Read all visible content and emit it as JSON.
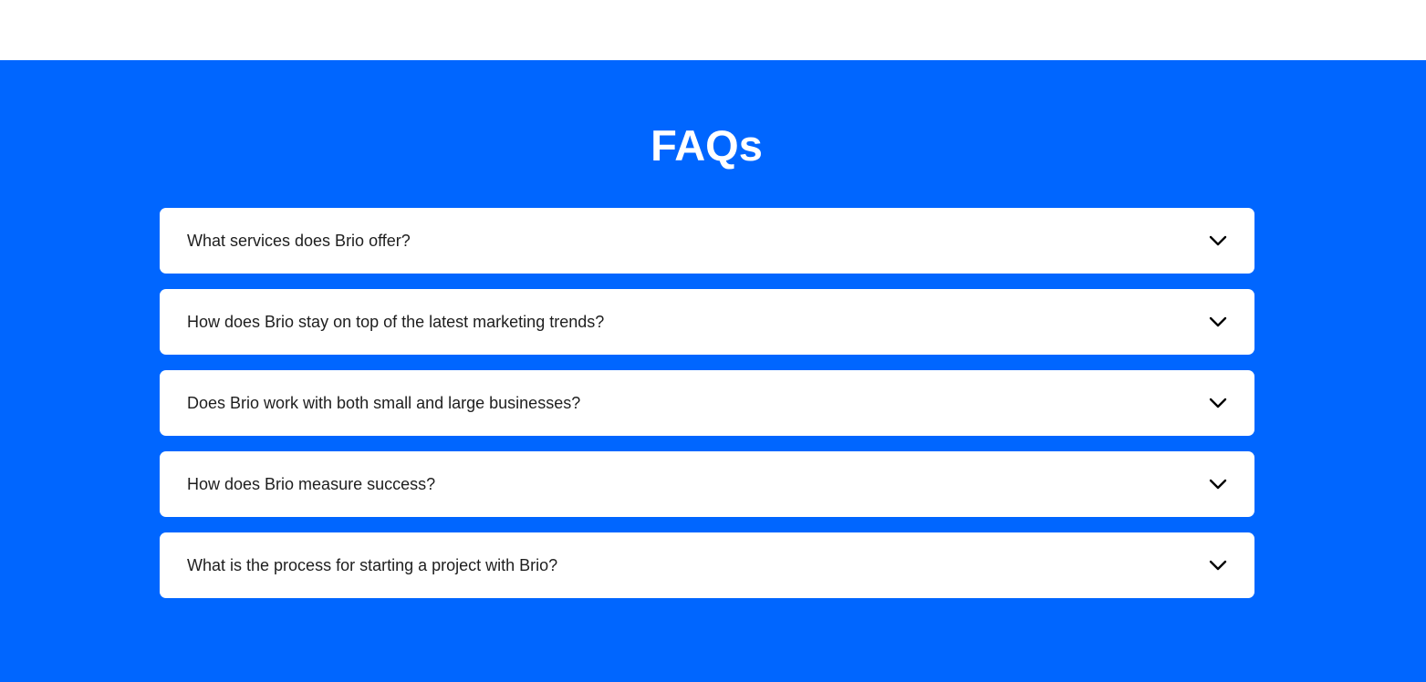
{
  "colors": {
    "section_background": "#0066ff",
    "card_background": "#ffffff",
    "title_color": "#ffffff",
    "question_color": "#1e1e1e"
  },
  "faq": {
    "title": "FAQs",
    "items": [
      {
        "question": "What services does Brio offer?",
        "icon": "chevron-down-icon"
      },
      {
        "question": "How does Brio stay on top of the latest marketing trends?",
        "icon": "chevron-down-icon"
      },
      {
        "question": "Does Brio work with both small and large businesses?",
        "icon": "chevron-down-icon"
      },
      {
        "question": "How does Brio measure success?",
        "icon": "chevron-down-icon"
      },
      {
        "question": "What is the process for starting a project with Brio?",
        "icon": "chevron-down-icon"
      }
    ]
  }
}
